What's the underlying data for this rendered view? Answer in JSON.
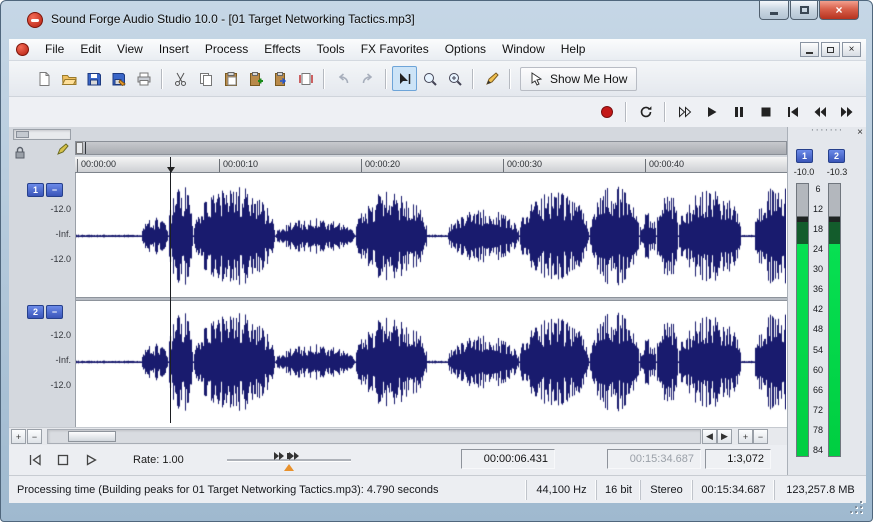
{
  "window": {
    "title": "Sound Forge Audio Studio 10.0 - [01 Target Networking Tactics.mp3]"
  },
  "menu": {
    "items": [
      "File",
      "Edit",
      "View",
      "Insert",
      "Process",
      "Effects",
      "Tools",
      "FX Favorites",
      "Options",
      "Window",
      "Help"
    ]
  },
  "toolbar": {
    "show_me_how_label": "Show Me How"
  },
  "ruler": {
    "ticks": [
      "00:00:00",
      "00:00:10",
      "00:00:20",
      "00:00:30",
      "00:00:40"
    ]
  },
  "tracks": {
    "channel1": {
      "number": "1",
      "levels": [
        "-12.0",
        "-Inf.",
        "-12.0"
      ]
    },
    "channel2": {
      "number": "2",
      "levels": [
        "-12.0",
        "-Inf.",
        "-12.0"
      ]
    }
  },
  "playbar": {
    "rate_label": "Rate: 1.00",
    "position": "00:00:06.431",
    "total_length": "00:15:34.687",
    "zoom_ratio": "1:3,072"
  },
  "meters": {
    "channel_labels": [
      "1",
      "2"
    ],
    "peaks": [
      "-10.0",
      "-10.3"
    ],
    "scale": [
      "6",
      "12",
      "18",
      "24",
      "30",
      "36",
      "42",
      "48",
      "54",
      "60",
      "66",
      "72",
      "78",
      "84"
    ]
  },
  "status_bar": {
    "message": "Processing time (Building peaks for 01 Target Networking Tactics.mp3): 4.790 seconds",
    "sample_rate": "44,100 Hz",
    "bit_depth": "16 bit",
    "channel_mode": "Stereo",
    "length": "00:15:34.687",
    "free_space": "123,257.8 MB"
  },
  "glyphs": {
    "close_x": "×",
    "scroll_left": "◀",
    "scroll_right": "▶",
    "plus": "+",
    "minus": "−",
    "channel_minimize": "−",
    "grip_dots": "·······"
  },
  "colors": {
    "waveform": "#191b6e",
    "meter_green": "#00d84a",
    "record_red": "#c41818",
    "channel_badge_blue": "#4a6bd8"
  }
}
